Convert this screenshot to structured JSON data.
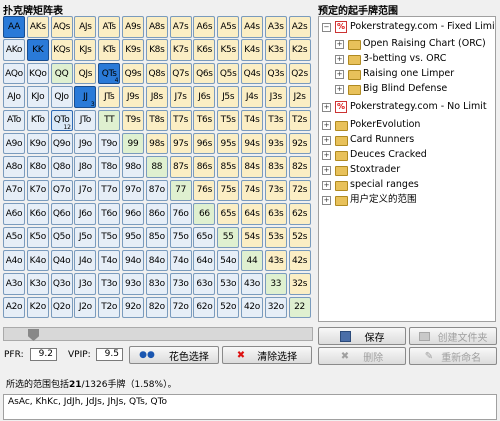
{
  "left_title": "扑克牌矩阵表",
  "right_title": "预定的起手牌范围",
  "grid": [
    [
      {
        "t": "AA",
        "s": "sel"
      },
      {
        "t": "AKs",
        "s": "suited"
      },
      {
        "t": "AQs",
        "s": "suited"
      },
      {
        "t": "AJs",
        "s": "suited"
      },
      {
        "t": "ATs",
        "s": "suited"
      },
      {
        "t": "A9s",
        "s": "suited"
      },
      {
        "t": "A8s",
        "s": "suited"
      },
      {
        "t": "A7s",
        "s": "suited"
      },
      {
        "t": "A6s",
        "s": "suited"
      },
      {
        "t": "A5s",
        "s": "suited"
      },
      {
        "t": "A4s",
        "s": "suited"
      },
      {
        "t": "A3s",
        "s": "suited"
      },
      {
        "t": "A2s",
        "s": "suited"
      }
    ],
    [
      {
        "t": "AKo",
        "s": "off"
      },
      {
        "t": "KK",
        "s": "sel"
      },
      {
        "t": "KQs",
        "s": "suited"
      },
      {
        "t": "KJs",
        "s": "suited"
      },
      {
        "t": "KTs",
        "s": "suited"
      },
      {
        "t": "K9s",
        "s": "suited"
      },
      {
        "t": "K8s",
        "s": "suited"
      },
      {
        "t": "K7s",
        "s": "suited"
      },
      {
        "t": "K6s",
        "s": "suited"
      },
      {
        "t": "K5s",
        "s": "suited"
      },
      {
        "t": "K4s",
        "s": "suited"
      },
      {
        "t": "K3s",
        "s": "suited"
      },
      {
        "t": "K2s",
        "s": "suited"
      }
    ],
    [
      {
        "t": "AQo",
        "s": "off"
      },
      {
        "t": "KQo",
        "s": "off"
      },
      {
        "t": "QQ",
        "s": "pair"
      },
      {
        "t": "QJs",
        "s": "suited"
      },
      {
        "t": "QTs",
        "s": "sel",
        "b": "4"
      },
      {
        "t": "Q9s",
        "s": "suited"
      },
      {
        "t": "Q8s",
        "s": "suited"
      },
      {
        "t": "Q7s",
        "s": "suited"
      },
      {
        "t": "Q6s",
        "s": "suited"
      },
      {
        "t": "Q5s",
        "s": "suited"
      },
      {
        "t": "Q4s",
        "s": "suited"
      },
      {
        "t": "Q3s",
        "s": "suited"
      },
      {
        "t": "Q2s",
        "s": "suited"
      }
    ],
    [
      {
        "t": "AJo",
        "s": "off"
      },
      {
        "t": "KJo",
        "s": "off"
      },
      {
        "t": "QJo",
        "s": "off"
      },
      {
        "t": "JJ",
        "s": "sel",
        "b": "3"
      },
      {
        "t": "JTs",
        "s": "suited"
      },
      {
        "t": "J9s",
        "s": "suited"
      },
      {
        "t": "J8s",
        "s": "suited"
      },
      {
        "t": "J7s",
        "s": "suited"
      },
      {
        "t": "J6s",
        "s": "suited"
      },
      {
        "t": "J5s",
        "s": "suited"
      },
      {
        "t": "J4s",
        "s": "suited"
      },
      {
        "t": "J3s",
        "s": "suited"
      },
      {
        "t": "J2s",
        "s": "suited"
      }
    ],
    [
      {
        "t": "ATo",
        "s": "off"
      },
      {
        "t": "KTo",
        "s": "off"
      },
      {
        "t": "QTo",
        "s": "sel2",
        "b": "12"
      },
      {
        "t": "JTo",
        "s": "off"
      },
      {
        "t": "TT",
        "s": "pair"
      },
      {
        "t": "T9s",
        "s": "suited"
      },
      {
        "t": "T8s",
        "s": "suited"
      },
      {
        "t": "T7s",
        "s": "suited"
      },
      {
        "t": "T6s",
        "s": "suited"
      },
      {
        "t": "T5s",
        "s": "suited"
      },
      {
        "t": "T4s",
        "s": "suited"
      },
      {
        "t": "T3s",
        "s": "suited"
      },
      {
        "t": "T2s",
        "s": "suited"
      }
    ],
    [
      {
        "t": "A9o",
        "s": "off"
      },
      {
        "t": "K9o",
        "s": "off"
      },
      {
        "t": "Q9o",
        "s": "off"
      },
      {
        "t": "J9o",
        "s": "off"
      },
      {
        "t": "T9o",
        "s": "off"
      },
      {
        "t": "99",
        "s": "pair"
      },
      {
        "t": "98s",
        "s": "suited"
      },
      {
        "t": "97s",
        "s": "suited"
      },
      {
        "t": "96s",
        "s": "suited"
      },
      {
        "t": "95s",
        "s": "suited"
      },
      {
        "t": "94s",
        "s": "suited"
      },
      {
        "t": "93s",
        "s": "suited"
      },
      {
        "t": "92s",
        "s": "suited"
      }
    ],
    [
      {
        "t": "A8o",
        "s": "off"
      },
      {
        "t": "K8o",
        "s": "off"
      },
      {
        "t": "Q8o",
        "s": "off"
      },
      {
        "t": "J8o",
        "s": "off"
      },
      {
        "t": "T8o",
        "s": "off"
      },
      {
        "t": "98o",
        "s": "off"
      },
      {
        "t": "88",
        "s": "pair"
      },
      {
        "t": "87s",
        "s": "suited"
      },
      {
        "t": "86s",
        "s": "suited"
      },
      {
        "t": "85s",
        "s": "suited"
      },
      {
        "t": "84s",
        "s": "suited"
      },
      {
        "t": "83s",
        "s": "suited"
      },
      {
        "t": "82s",
        "s": "suited"
      }
    ],
    [
      {
        "t": "A7o",
        "s": "off"
      },
      {
        "t": "K7o",
        "s": "off"
      },
      {
        "t": "Q7o",
        "s": "off"
      },
      {
        "t": "J7o",
        "s": "off"
      },
      {
        "t": "T7o",
        "s": "off"
      },
      {
        "t": "97o",
        "s": "off"
      },
      {
        "t": "87o",
        "s": "off"
      },
      {
        "t": "77",
        "s": "pair"
      },
      {
        "t": "76s",
        "s": "suited"
      },
      {
        "t": "75s",
        "s": "suited"
      },
      {
        "t": "74s",
        "s": "suited"
      },
      {
        "t": "73s",
        "s": "suited"
      },
      {
        "t": "72s",
        "s": "suited"
      }
    ],
    [
      {
        "t": "A6o",
        "s": "off"
      },
      {
        "t": "K6o",
        "s": "off"
      },
      {
        "t": "Q6o",
        "s": "off"
      },
      {
        "t": "J6o",
        "s": "off"
      },
      {
        "t": "T6o",
        "s": "off"
      },
      {
        "t": "96o",
        "s": "off"
      },
      {
        "t": "86o",
        "s": "off"
      },
      {
        "t": "76o",
        "s": "off"
      },
      {
        "t": "66",
        "s": "pair"
      },
      {
        "t": "65s",
        "s": "suited"
      },
      {
        "t": "64s",
        "s": "suited"
      },
      {
        "t": "63s",
        "s": "suited"
      },
      {
        "t": "62s",
        "s": "suited"
      }
    ],
    [
      {
        "t": "A5o",
        "s": "off"
      },
      {
        "t": "K5o",
        "s": "off"
      },
      {
        "t": "Q5o",
        "s": "off"
      },
      {
        "t": "J5o",
        "s": "off"
      },
      {
        "t": "T5o",
        "s": "off"
      },
      {
        "t": "95o",
        "s": "off"
      },
      {
        "t": "85o",
        "s": "off"
      },
      {
        "t": "75o",
        "s": "off"
      },
      {
        "t": "65o",
        "s": "off"
      },
      {
        "t": "55",
        "s": "pair"
      },
      {
        "t": "54s",
        "s": "suited"
      },
      {
        "t": "53s",
        "s": "suited"
      },
      {
        "t": "52s",
        "s": "suited"
      }
    ],
    [
      {
        "t": "A4o",
        "s": "off"
      },
      {
        "t": "K4o",
        "s": "off"
      },
      {
        "t": "Q4o",
        "s": "off"
      },
      {
        "t": "J4o",
        "s": "off"
      },
      {
        "t": "T4o",
        "s": "off"
      },
      {
        "t": "94o",
        "s": "off"
      },
      {
        "t": "84o",
        "s": "off"
      },
      {
        "t": "74o",
        "s": "off"
      },
      {
        "t": "64o",
        "s": "off"
      },
      {
        "t": "54o",
        "s": "off"
      },
      {
        "t": "44",
        "s": "pair"
      },
      {
        "t": "43s",
        "s": "suited"
      },
      {
        "t": "42s",
        "s": "suited"
      }
    ],
    [
      {
        "t": "A3o",
        "s": "off"
      },
      {
        "t": "K3o",
        "s": "off"
      },
      {
        "t": "Q3o",
        "s": "off"
      },
      {
        "t": "J3o",
        "s": "off"
      },
      {
        "t": "T3o",
        "s": "off"
      },
      {
        "t": "93o",
        "s": "off"
      },
      {
        "t": "83o",
        "s": "off"
      },
      {
        "t": "73o",
        "s": "off"
      },
      {
        "t": "63o",
        "s": "off"
      },
      {
        "t": "53o",
        "s": "off"
      },
      {
        "t": "43o",
        "s": "off"
      },
      {
        "t": "33",
        "s": "pair"
      },
      {
        "t": "32s",
        "s": "suited"
      }
    ],
    [
      {
        "t": "A2o",
        "s": "off"
      },
      {
        "t": "K2o",
        "s": "off"
      },
      {
        "t": "Q2o",
        "s": "off"
      },
      {
        "t": "J2o",
        "s": "off"
      },
      {
        "t": "T2o",
        "s": "off"
      },
      {
        "t": "92o",
        "s": "off"
      },
      {
        "t": "82o",
        "s": "off"
      },
      {
        "t": "72o",
        "s": "off"
      },
      {
        "t": "62o",
        "s": "off"
      },
      {
        "t": "52o",
        "s": "off"
      },
      {
        "t": "42o",
        "s": "off"
      },
      {
        "t": "32o",
        "s": "off"
      },
      {
        "t": "22",
        "s": "pair"
      }
    ]
  ],
  "colors": {
    "pair": "#dff0d0",
    "suited": "#fbeec4",
    "offsuit": "#e6eef7",
    "selected": "#2a7ad8"
  },
  "tree": [
    {
      "label": "Pokerstrategy.com - Fixed Limit",
      "icon": "poker-icon",
      "expanded": true,
      "level": 0,
      "children_index": 0
    },
    {
      "label": "Open Raising Chart (ORC)",
      "icon": "folder-icon",
      "level": 1
    },
    {
      "label": "3-betting vs. ORC",
      "icon": "folder-icon",
      "level": 1
    },
    {
      "label": "Raising one Limper",
      "icon": "folder-icon",
      "level": 1
    },
    {
      "label": "Big Blind Defense",
      "icon": "folder-icon",
      "level": 1
    },
    {
      "label": "Pokerstrategy.com - No Limit",
      "icon": "poker-icon",
      "level": 0
    },
    {
      "label": "PokerEvolution",
      "icon": "folder-icon",
      "level": 0
    },
    {
      "label": "Card Runners",
      "icon": "folder-icon",
      "level": 0
    },
    {
      "label": "Deuces Cracked",
      "icon": "folder-icon",
      "level": 0
    },
    {
      "label": "Stoxtrader",
      "icon": "folder-icon",
      "level": 0
    },
    {
      "label": "special ranges",
      "icon": "folder-icon",
      "level": 0
    },
    {
      "label": "用户定义的范围",
      "icon": "folder-icon",
      "level": 0
    }
  ],
  "controls": {
    "pfr_label": "PFR:",
    "pfr_value": "9.2",
    "vpip_label": "VPIP:",
    "vpip_value": "9.5",
    "suit_select_label": "花色选择",
    "clear_label": "清除选择",
    "save_label": "保存",
    "create_folder_label": "创建文件夹",
    "delete_label": "删除",
    "rename_label": "重新命名"
  },
  "summary": {
    "prefix": "所选的范围包括",
    "count": "21",
    "total": "/1326手牌（1.58%）。"
  },
  "combos": "AsAc, KhKc, JdJh, JdJs, JhJs, QTs, QTo"
}
